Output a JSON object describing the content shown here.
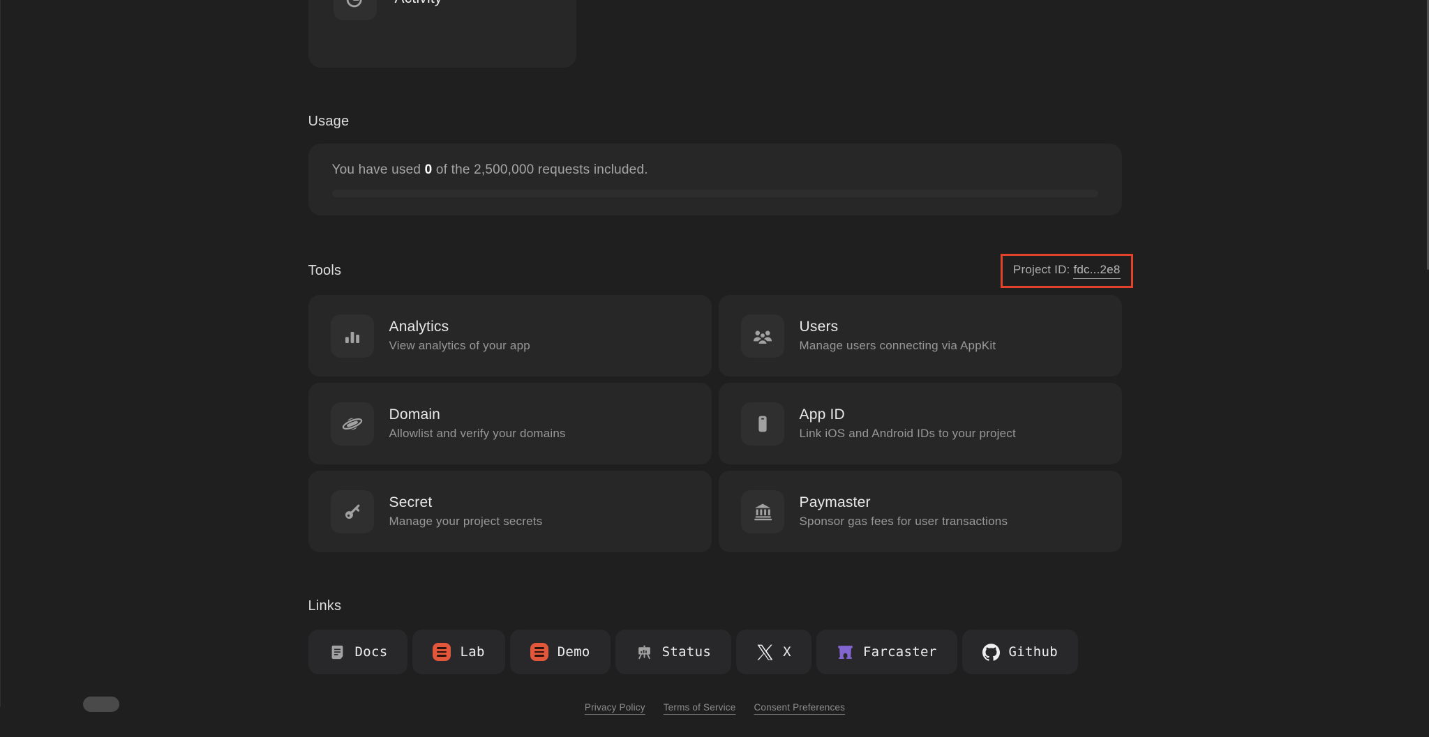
{
  "activity_card": {
    "label": "Activity"
  },
  "usage": {
    "heading": "Usage",
    "text_prefix": "You have used ",
    "used": "0",
    "text_suffix": " of the 2,500,000 requests included.",
    "progress_percent": 0
  },
  "tools": {
    "heading": "Tools",
    "project_id": {
      "label": "Project ID:",
      "value": "fdc...2e8",
      "highlight_color": "#e2422b"
    },
    "cards": [
      {
        "title": "Analytics",
        "subtitle": "View analytics of your app",
        "icon": "bar-chart-icon"
      },
      {
        "title": "Users",
        "subtitle": "Manage users connecting via AppKit",
        "icon": "users-icon"
      },
      {
        "title": "Domain",
        "subtitle": "Allowlist and verify your domains",
        "icon": "planet-icon"
      },
      {
        "title": "App ID",
        "subtitle": "Link iOS and Android IDs to your project",
        "icon": "smartphone-icon"
      },
      {
        "title": "Secret",
        "subtitle": "Manage your project secrets",
        "icon": "key-icon"
      },
      {
        "title": "Paymaster",
        "subtitle": "Sponsor gas fees for user transactions",
        "icon": "bank-icon"
      }
    ]
  },
  "links": {
    "heading": "Links",
    "items": [
      {
        "label": "Docs",
        "icon": "docs-icon"
      },
      {
        "label": "Lab",
        "icon": "reown-lab-icon",
        "icon_color": "#e2573b"
      },
      {
        "label": "Demo",
        "icon": "reown-demo-icon",
        "icon_color": "#e2573b"
      },
      {
        "label": "Status",
        "icon": "status-icon"
      },
      {
        "label": "X",
        "icon": "x-icon"
      },
      {
        "label": "Farcaster",
        "icon": "farcaster-icon",
        "icon_color": "#8165d0"
      },
      {
        "label": "Github",
        "icon": "github-icon"
      }
    ]
  },
  "footer": {
    "links": [
      "Privacy Policy",
      "Terms of Service",
      "Consent Preferences"
    ]
  }
}
